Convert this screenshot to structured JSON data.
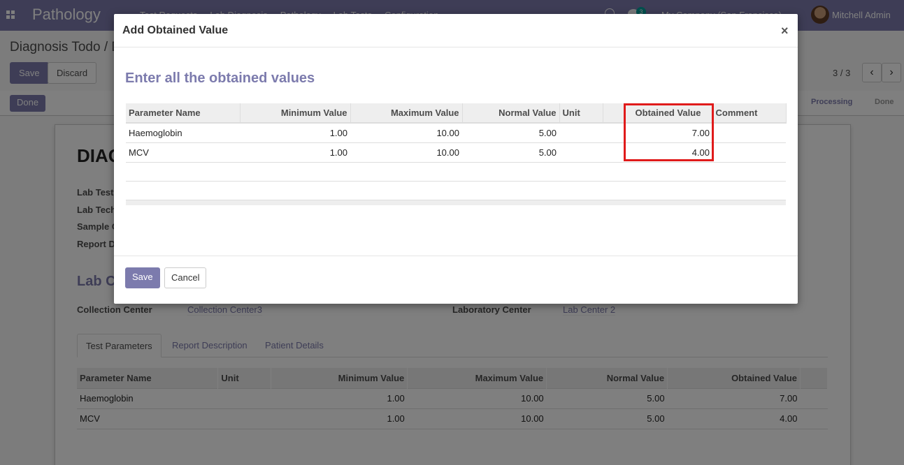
{
  "navbar": {
    "brand": "Pathology",
    "menu": [
      "Test Requests",
      "Lab Diagnosis",
      "Pathology",
      "Lab Tests",
      "Configuration"
    ],
    "chat_count": "3",
    "company": "My Company (San Francisco)",
    "user": "Mitchell Admin"
  },
  "control": {
    "breadcrumb": "Diagnosis Todo / D",
    "save_label": "Save",
    "discard_label": "Discard",
    "pager": "3 / 3",
    "prev_icon": "‹",
    "next_icon": "›"
  },
  "statusbar": {
    "done_button": "Done",
    "stages": [
      "Processing",
      "Done"
    ]
  },
  "form": {
    "title": "DIAG",
    "labels": [
      "Lab Test",
      "Lab Tech",
      "Sample C",
      "Report D"
    ],
    "section_title": "Lab C",
    "collection_center_label": "Collection Center",
    "collection_center_value": "Collection Center3",
    "laboratory_center_label": "Laboratory Center",
    "laboratory_center_value": "Lab Center 2",
    "tabs": [
      "Test Parameters",
      "Report Description",
      "Patient Details"
    ],
    "table": {
      "headers": [
        "Parameter Name",
        "Unit",
        "Minimum Value",
        "Maximum Value",
        "Normal Value",
        "Obtained Value"
      ],
      "rows": [
        {
          "name": "Haemoglobin",
          "unit": "",
          "min": "1.00",
          "max": "10.00",
          "normal": "5.00",
          "obtained": "7.00"
        },
        {
          "name": "MCV",
          "unit": "",
          "min": "1.00",
          "max": "10.00",
          "normal": "5.00",
          "obtained": "4.00"
        }
      ]
    }
  },
  "modal": {
    "title": "Add Obtained Value",
    "close": "×",
    "heading": "Enter all the obtained values",
    "headers": [
      "Parameter Name",
      "Minimum Value",
      "Maximum Value",
      "Normal Value",
      "Unit",
      "",
      "Obtained Value",
      "Comment"
    ],
    "rows": [
      {
        "name": "Haemoglobin",
        "min": "1.00",
        "max": "10.00",
        "normal": "5.00",
        "unit": "",
        "obtained": "7.00",
        "comment": ""
      },
      {
        "name": "MCV",
        "min": "1.00",
        "max": "10.00",
        "normal": "5.00",
        "unit": "",
        "obtained": "4.00",
        "comment": ""
      }
    ],
    "save_label": "Save",
    "cancel_label": "Cancel"
  },
  "colors": {
    "brand": "#7c7bad",
    "highlight": "#e01b1b"
  }
}
